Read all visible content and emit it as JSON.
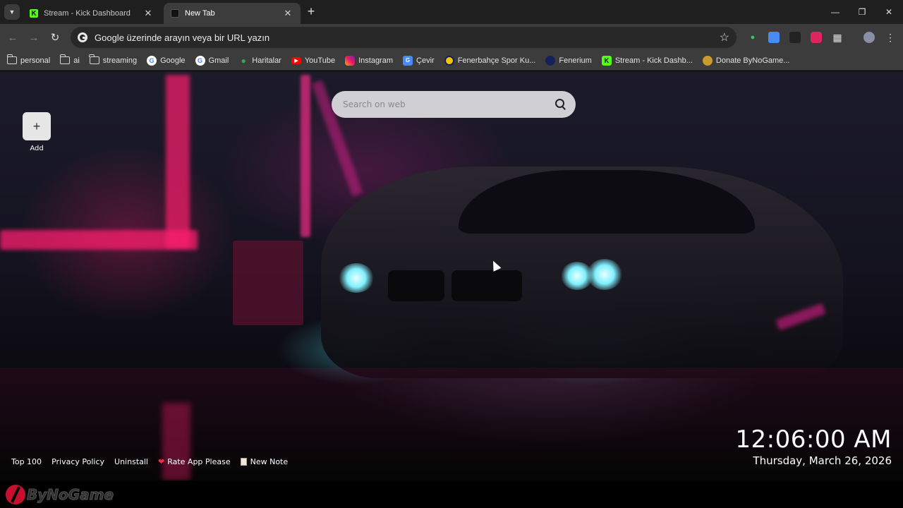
{
  "tabs": [
    {
      "title": "Stream - Kick Dashboard",
      "favicon": "kick-icon",
      "active": false
    },
    {
      "title": "New Tab",
      "favicon": "newtab-icon",
      "active": true
    }
  ],
  "toolbar": {
    "omnibox_placeholder": "Google üzerinde arayın veya bir URL yazın"
  },
  "bookmarks": [
    {
      "label": "personal",
      "icon": "folder-icon"
    },
    {
      "label": "ai",
      "icon": "folder-icon"
    },
    {
      "label": "streaming",
      "icon": "folder-icon"
    },
    {
      "label": "Google",
      "icon": "google-icon"
    },
    {
      "label": "Gmail",
      "icon": "google-icon"
    },
    {
      "label": "Haritalar",
      "icon": "maps-icon"
    },
    {
      "label": "YouTube",
      "icon": "youtube-icon"
    },
    {
      "label": "Instagram",
      "icon": "instagram-icon"
    },
    {
      "label": "Çevir",
      "icon": "translate-icon"
    },
    {
      "label": "Fenerbahçe Spor Ku...",
      "icon": "fenerbahce-icon"
    },
    {
      "label": "Fenerium",
      "icon": "fenerium-icon"
    },
    {
      "label": "Stream - Kick Dashb...",
      "icon": "kick-icon"
    },
    {
      "label": "Donate ByNoGame...",
      "icon": "bynogame-icon"
    }
  ],
  "newtab": {
    "search_placeholder": "Search on web",
    "add_label": "Add",
    "footer": {
      "top100": "Top 100",
      "privacy": "Privacy Policy",
      "uninstall": "Uninstall",
      "rate": "Rate App Please",
      "note": "New Note"
    },
    "clock": {
      "time": "12:06:00 AM",
      "date": "Thursday, March 26, 2026"
    }
  },
  "colors": {
    "tabstrip": "#1f1f1f",
    "toolbar": "#3c3c3c",
    "neon_pink": "#ff1e6e",
    "headlight_cyan": "#7ff0ff",
    "kick_green": "#53fc18"
  }
}
